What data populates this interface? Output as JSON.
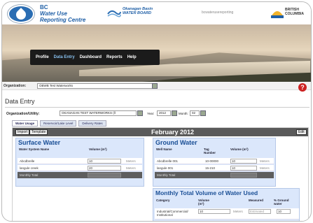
{
  "header": {
    "brand_line1": "BC",
    "brand_line2": "Water Use",
    "brand_line3": "Reporting Centre",
    "partner_name": "Okanagan Basin",
    "partner_sub": "WATER BOARD",
    "top_link": "bcwaterusereporting",
    "province_line1": "BRITISH",
    "province_line2": "COLUMBIA"
  },
  "nav": {
    "items": [
      {
        "label": "Profile",
        "active": false
      },
      {
        "label": "Data Entry",
        "active": true
      },
      {
        "label": "Dashboard",
        "active": false
      },
      {
        "label": "Reports",
        "active": false
      },
      {
        "label": "Help",
        "active": false
      }
    ]
  },
  "org": {
    "label": "Organization:",
    "value": "OBWB Test Waterworks"
  },
  "help_icon": "?",
  "page_title": "Data Entry",
  "utility": {
    "label": "Organization/Utility:",
    "value": "OKANAGAN TEST WATERWORKS (ll",
    "year_label": "Year:",
    "year_value": "2012",
    "month_label": "Month:",
    "month_value": "02"
  },
  "tabs": [
    {
      "label": "Water Usage",
      "active": true
    },
    {
      "label": "Reservoir/Lake Level",
      "active": false
    },
    {
      "label": "Delivery Rates",
      "active": false
    }
  ],
  "toolbar": {
    "import_label": "Import",
    "template_label": "Template",
    "period_title": "February 2012",
    "edit_label": "Edit"
  },
  "surface_water": {
    "title": "Surface Water",
    "col_name": "Water System Name",
    "col_volume": "Volume (m³)",
    "rows": [
      {
        "name": "Abcdbrelle",
        "volume": "10",
        "unit": "Meters"
      },
      {
        "name": "langule creek",
        "volume": "20",
        "unit": "Meters"
      }
    ],
    "monthly_total_label": "Monthly Total"
  },
  "ground_water": {
    "title": "Ground Water",
    "col_name": "Well Name",
    "col_tag": "Tag Number",
    "col_volume": "Volume (m³)",
    "rows": [
      {
        "name": "Abcdbrelle 001",
        "tag": "10-00000",
        "volume": "10",
        "unit": "Meters"
      },
      {
        "name": "langule 001",
        "tag": "15-210",
        "volume": "10",
        "unit": "Meters"
      }
    ],
    "monthly_total_label": "Monthly Total"
  },
  "monthly_total": {
    "title": "Monthly Total Volume of Water Used",
    "col_category": "Category",
    "col_volume": "Volume (m³)",
    "col_measured": "Measured",
    "col_percent": "% Ground water",
    "row_category": "Industrial/Commercial/ Institutional",
    "row_volume": "10",
    "row_unit": "Meters",
    "row_measured": "Estimated",
    "row_percent": "10"
  },
  "colors": {
    "brand_blue": "#1f5fa6",
    "nav_bg": "#1b1b1b",
    "section_bg": "#dbe7fb",
    "toolbar_bg": "#5a5a5a",
    "help_red": "#cc2222"
  }
}
